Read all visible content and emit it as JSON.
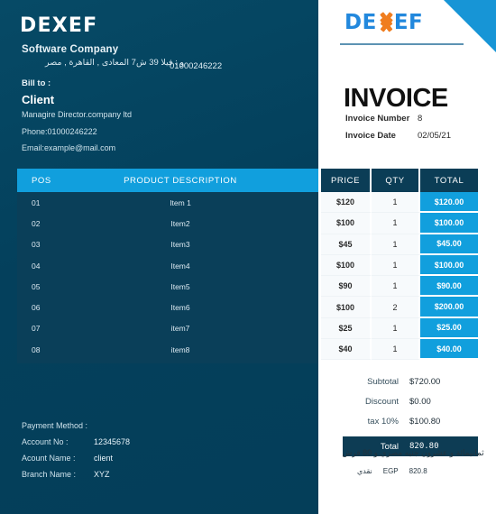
{
  "left": {
    "logo_text": "DEXEF",
    "company_name": "Software Company",
    "address_ar": "و : فيلا 39 ش7 المعادى  ,  القاهرة  ,  مصر",
    "company_phone": "01000246222",
    "bill_to_label": "Bill to :",
    "client_name": "Client",
    "client_role": "Managire Director.company ltd",
    "client_phone": "Phone:01000246222",
    "client_email": "Email:example@mail.com",
    "payment": {
      "method_label": "Payment Method :",
      "method_value": "",
      "account_no_label": "Account No :",
      "account_no_value": "12345678",
      "account_name_label": "Acount Name :",
      "account_name_value": "client",
      "branch_label": "Branch Name :",
      "branch_value": "XYZ"
    }
  },
  "right": {
    "logo_part1": "DE",
    "logo_part2": "EF",
    "invoice_title": "INVOICE",
    "invoice_number_label": "Invoice Number",
    "invoice_number_value": "8",
    "invoice_date_label": "Invoice Date",
    "invoice_date_value": "02/05/21"
  },
  "table": {
    "headers": {
      "pos": "POS",
      "description": "PRODUCT  DESCRIPTION",
      "price": "PRICE",
      "qty": "QTY",
      "total": "TOTAL"
    },
    "rows": [
      {
        "pos": "01",
        "description": "Item 1",
        "price": "$120",
        "qty": "1",
        "total": "$120.00"
      },
      {
        "pos": "02",
        "description": "Item2",
        "price": "$100",
        "qty": "1",
        "total": "$100.00"
      },
      {
        "pos": "03",
        "description": "Item3",
        "price": "$45",
        "qty": "1",
        "total": "$45.00"
      },
      {
        "pos": "04",
        "description": "Item4",
        "price": "$100",
        "qty": "1",
        "total": "$100.00"
      },
      {
        "pos": "05",
        "description": "Item5",
        "price": "$90",
        "qty": "1",
        "total": "$90.00"
      },
      {
        "pos": "06",
        "description": "Item6",
        "price": "$100",
        "qty": "2",
        "total": "$200.00"
      },
      {
        "pos": "07",
        "description": "item7",
        "price": "$25",
        "qty": "1",
        "total": "$25.00"
      },
      {
        "pos": "08",
        "description": "item8",
        "price": "$40",
        "qty": "1",
        "total": "$40.00"
      }
    ]
  },
  "totals": {
    "subtotal_label": "Subtotal",
    "subtotal_value": "$720.00",
    "discount_label": "Discount",
    "discount_value": "$0.00",
    "tax_label": "tax 10%",
    "tax_value": "$100.80",
    "total_label": "Total",
    "total_value": "820.80",
    "amount_in_words_ar": "ثمانيمائة و عشرون جنيه مصري  و 80 قرش",
    "payment_mode_ar": "نقدي",
    "currency_code": "EGP",
    "currency_amount": "820.8"
  },
  "colors": {
    "panel_navy": "#04405c",
    "table_navy": "#0a3f59",
    "accent_blue": "#119fdd",
    "header_navy": "#0b3d56",
    "logo_blue": "#2288dd",
    "logo_orange": "#f07d1e"
  }
}
